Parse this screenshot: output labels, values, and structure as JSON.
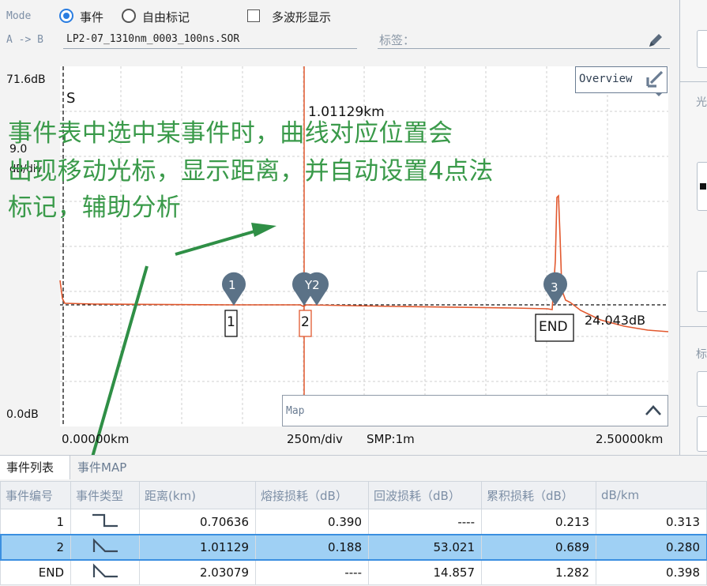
{
  "header": {
    "mode_label": "Mode",
    "ab_label": "A -> B",
    "radio_event": "事件",
    "radio_free": "自由标记",
    "checkbox_multi": "多波形显示",
    "filename": "LP2-07_1310nm_0003_100ns.SOR",
    "tag_placeholder": "标签："
  },
  "right_panel": {
    "label1": "光",
    "label2": "标"
  },
  "chart": {
    "y_top": "71.6dB",
    "y_bottom": "0.0dB",
    "scale_value": "9.0",
    "scale_unit": "dB/div",
    "start_marker": "S",
    "cursor_distance": "1.01129km",
    "end_loss": "24.043dB",
    "overview_button": "Overview",
    "map_label": "Map",
    "x_start": "0.00000km",
    "x_div": "250m/div",
    "x_smp": "SMP:1m",
    "x_end": "2.50000km",
    "pins": [
      "1",
      "Y2",
      "3"
    ],
    "event_boxes": [
      "1",
      "2",
      "END"
    ]
  },
  "annotation": {
    "line1": "事件表中选中某事件时，曲线对应位置会",
    "line2": "出现移动光标，显示距离，并自动设置4点法",
    "line3": "标记，辅助分析"
  },
  "tabs": [
    "事件列表",
    "事件MAP"
  ],
  "table": {
    "columns": [
      "事件编号",
      "事件类型",
      "距离(km)",
      "熔接损耗（dB）",
      "回波损耗（dB）",
      "累积损耗（dB）",
      "dB/km"
    ],
    "rows": [
      {
        "id": "1",
        "type": "non-reflective-icon",
        "distance": "0.70636",
        "splice": "0.390",
        "return": "----",
        "cumulative": "0.213",
        "dbkm": "0.313",
        "selected": false
      },
      {
        "id": "2",
        "type": "reflective-icon",
        "distance": "1.01129",
        "splice": "0.188",
        "return": "53.021",
        "cumulative": "0.689",
        "dbkm": "0.280",
        "selected": true
      },
      {
        "id": "END",
        "type": "reflective-icon",
        "distance": "2.03079",
        "splice": "----",
        "return": "14.857",
        "cumulative": "1.282",
        "dbkm": "0.398",
        "selected": false
      }
    ]
  },
  "colors": {
    "accent": "#2a7de1",
    "trace": "#e2592f",
    "cursor": "#e2592f",
    "annotation": "#3a9a4a",
    "selection": "#9fd0f4"
  }
}
